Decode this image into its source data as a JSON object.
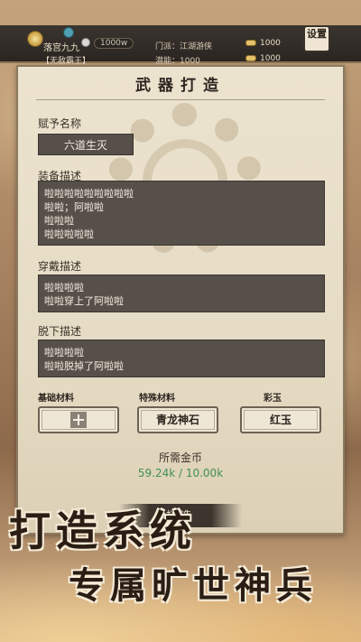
{
  "topbar": {
    "player_name": "落宫九九",
    "player_title": "【无敌霸王】",
    "silver": "1000w",
    "sect": "门派：江湖游侠",
    "potential": "潜能：1000",
    "gold_top": "1000",
    "gold_bottom": "1000",
    "settings_label": "设置"
  },
  "panel": {
    "title": "武器打造",
    "name_label": "赋予名称",
    "name_value": "六道生灭",
    "equip_desc_label": "装备描述",
    "equip_desc_lines": [
      "啦啦啦啦啦啦啦啦啦",
      "啦啦；阿啦啦",
      "啦啦啦",
      "啦啦啦啦啦"
    ],
    "wear_desc_label": "穿戴描述",
    "wear_desc_lines": [
      "啦啦啦啦",
      "啦啦穿上了阿啦啦"
    ],
    "remove_desc_label": "脱下描述",
    "remove_desc_lines": [
      "啦啦啦啦",
      "啦啦脱掉了阿啦啦"
    ],
    "materials": {
      "basic_label": "基础材料",
      "special_label": "特殊材料",
      "gem_label": "彩玉",
      "special_value": "青龙神石",
      "gem_value": "红玉"
    },
    "cost_label": "所需金币",
    "cost_value": "59.24k / 10.00k",
    "forge_button": "打造"
  },
  "promo": {
    "line1": "打造系统",
    "line2": "专属旷世神兵"
  },
  "colors": {
    "parchment": "#ece3cf",
    "dark_box": "#57504a",
    "cost_green": "#3f8f5a",
    "topbar": "#2a2521"
  },
  "icons": {
    "add_material": "plus-icon",
    "silver": "silver-coin-icon",
    "gold": "gold-ingot-icon"
  }
}
